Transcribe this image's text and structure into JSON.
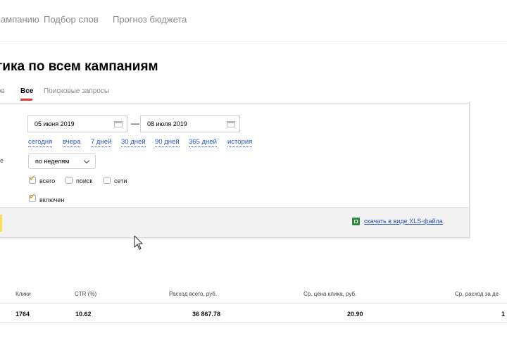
{
  "topnav": {
    "items": [
      {
        "label": "пампанию"
      },
      {
        "label": "Подбор слов"
      },
      {
        "label": "Прогноз бюджета"
      }
    ]
  },
  "page": {
    "title": "тика по всем кампаниям"
  },
  "tabs": [
    {
      "label": "ов",
      "active": false
    },
    {
      "label": "Все",
      "active": true
    },
    {
      "label": "Поисковые запросы",
      "active": false
    }
  ],
  "filters": {
    "date_from": "05 июня 2019",
    "date_to": "08 июля 2019",
    "separator": "—",
    "quick_ranges": [
      "сегодня",
      "вчера",
      "7 дней",
      "30 дней",
      "90 дней",
      "365 дней",
      "история"
    ],
    "left_label": "е",
    "grouping": "по неделям",
    "checkboxes": [
      {
        "label": "всего",
        "checked": true
      },
      {
        "label": "поиск",
        "checked": false
      },
      {
        "label": "сети",
        "checked": false
      }
    ],
    "enabled": {
      "label": "включен",
      "checked": true
    }
  },
  "export": {
    "label": "скачать в виде XLS-файла",
    "icon": "xls-file-icon"
  },
  "table": {
    "headers": [
      "Клики",
      "CTR (%)",
      "Расход всего, руб.",
      "Ср. цена клика, руб.",
      "Ср. расход за де"
    ],
    "row": [
      "1764",
      "10.62",
      "36 867.78",
      "20.90",
      "1"
    ]
  },
  "colors": {
    "accent": "#ee3333",
    "link": "#2a55c0",
    "button": "#ffdb4d",
    "xls": "#2e8b3d"
  }
}
